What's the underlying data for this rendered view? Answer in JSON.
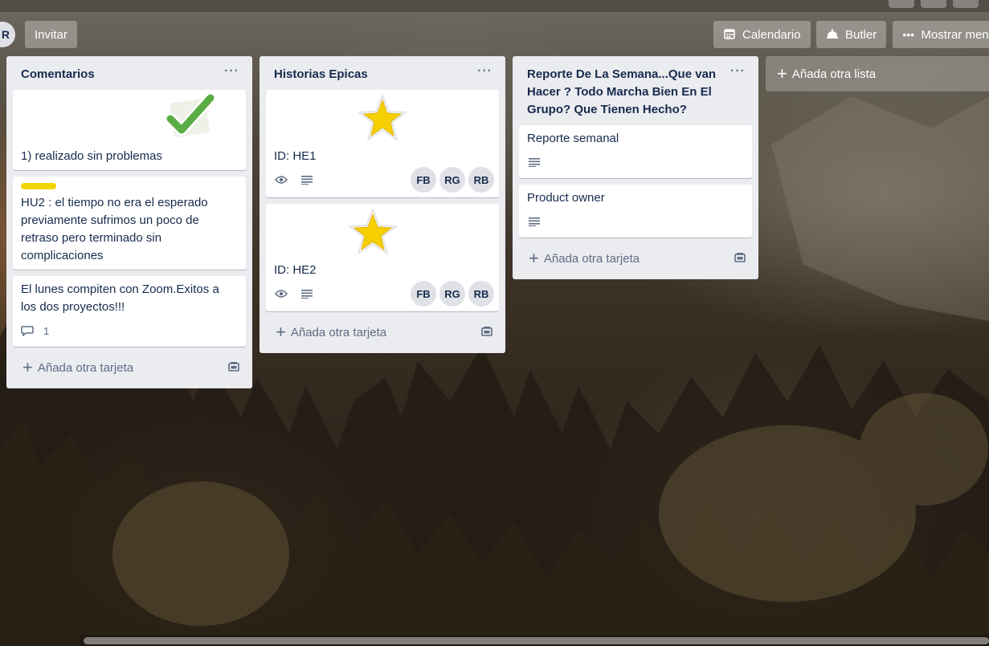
{
  "header": {
    "avatar_initial": "R",
    "invite_label": "Invitar",
    "calendar_label": "Calendario",
    "butler_label": "Butler",
    "show_menu_label": "Mostrar menú"
  },
  "lists": [
    {
      "title": "Comentarios",
      "cards": [
        {
          "text": "1) realizado sin problemas",
          "sticker": "checkmark-sticker"
        },
        {
          "label_color": "#f2d600",
          "text": "HU2 : el tiempo no era el esperado previamente sufrimos un poco de retraso pero terminado sin complicaciones"
        },
        {
          "text": "El lunes compiten con Zoom.Exitos a los dos proyectos!!!",
          "comments": "1"
        }
      ],
      "add_card_label": "Añada otra tarjeta"
    },
    {
      "title": "Historias Epicas",
      "cards": [
        {
          "text": "ID: HE1",
          "sticker": "star-sticker",
          "members": [
            "FB",
            "RG",
            "RB"
          ]
        },
        {
          "text": "ID: HE2",
          "sticker": "star-sticker",
          "members": [
            "FB",
            "RG",
            "RB"
          ]
        }
      ],
      "add_card_label": "Añada otra tarjeta"
    },
    {
      "title": "Reporte De La Semana...Que van Hacer ? Todo Marcha Bien En El Grupo? Que Tienen Hecho?",
      "cards": [
        {
          "text": "Reporte semanal"
        },
        {
          "text": "Product owner"
        }
      ],
      "add_card_label": "Añada otra tarjeta"
    }
  ],
  "add_list_label": "Añada otra lista",
  "colors": {
    "list_bg": "#ebecf0",
    "text": "#172b4d",
    "label_yellow": "#f2d600",
    "check_green": "#61bd4f",
    "star_yellow": "#f2d600"
  }
}
